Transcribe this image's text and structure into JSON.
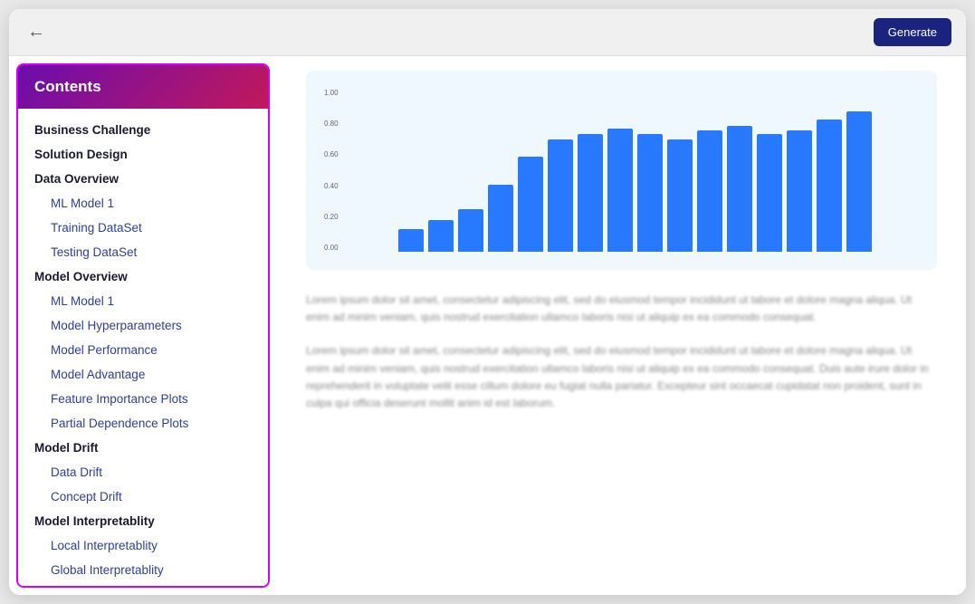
{
  "topbar": {
    "generate_label": "Generate"
  },
  "sidebar": {
    "header": "Contents",
    "items": [
      {
        "id": "business-challenge",
        "label": "Business Challenge",
        "level": "section"
      },
      {
        "id": "solution-design",
        "label": "Solution Design",
        "level": "section"
      },
      {
        "id": "data-overview",
        "label": "Data Overview",
        "level": "section"
      },
      {
        "id": "ml-model-1-data",
        "label": "ML Model 1",
        "level": "sub"
      },
      {
        "id": "training-dataset",
        "label": "Training DataSet",
        "level": "sub"
      },
      {
        "id": "testing-dataset",
        "label": "Testing DataSet",
        "level": "sub"
      },
      {
        "id": "model-overview",
        "label": "Model Overview",
        "level": "section"
      },
      {
        "id": "ml-model-1-model",
        "label": "ML Model 1",
        "level": "sub"
      },
      {
        "id": "model-hyperparameters",
        "label": "Model Hyperparameters",
        "level": "sub"
      },
      {
        "id": "model-performance",
        "label": "Model Performance",
        "level": "sub"
      },
      {
        "id": "model-advantage",
        "label": "Model Advantage",
        "level": "sub"
      },
      {
        "id": "feature-importance-plots",
        "label": "Feature Importance Plots",
        "level": "sub"
      },
      {
        "id": "partial-dependence-plots",
        "label": "Partial Dependence Plots",
        "level": "sub"
      },
      {
        "id": "model-drift",
        "label": "Model Drift",
        "level": "section"
      },
      {
        "id": "data-drift",
        "label": "Data Drift",
        "level": "sub"
      },
      {
        "id": "concept-drift",
        "label": "Concept Drift",
        "level": "sub"
      },
      {
        "id": "model-interpretability",
        "label": "Model Interpretablity",
        "level": "section"
      },
      {
        "id": "local-interpretability",
        "label": "Local Interpretablity",
        "level": "sub"
      },
      {
        "id": "global-interpretability",
        "label": "Global Interpretablity",
        "level": "sub"
      }
    ]
  },
  "chart": {
    "bars": [
      20,
      28,
      38,
      60,
      85,
      100,
      105,
      110,
      105,
      100,
      108,
      112,
      105,
      108,
      118,
      125
    ],
    "y_labels": [
      "1.00",
      "0.80",
      "0.60",
      "0.40",
      "0.20",
      "0.00"
    ]
  },
  "content": {
    "para1": "Lorem ipsum dolor sit amet, consectetur adipiscing elit, sed do eiusmod tempor incididunt ut labore et dolore magna aliqua. Ut enim ad minim veniam, quis nostrud exercitation ullamco laboris nisi ut aliquip ex ea commodo consequat.",
    "para2": "Lorem ipsum dolor sit amet, consectetur adipiscing elit, sed do eiusmod tempor incididunt ut labore et dolore magna aliqua. Ut enim ad minim veniam, quis nostrud exercitation ullamco laboris nisi ut aliquip ex ea commodo consequat. Duis aute irure dolor in reprehenderit in voluptate velit esse cillum dolore eu fugiat nulla pariatur. Excepteur sint occaecat cupidatat non proident, sunt in culpa qui officia deserunt mollit anim id est laborum."
  }
}
